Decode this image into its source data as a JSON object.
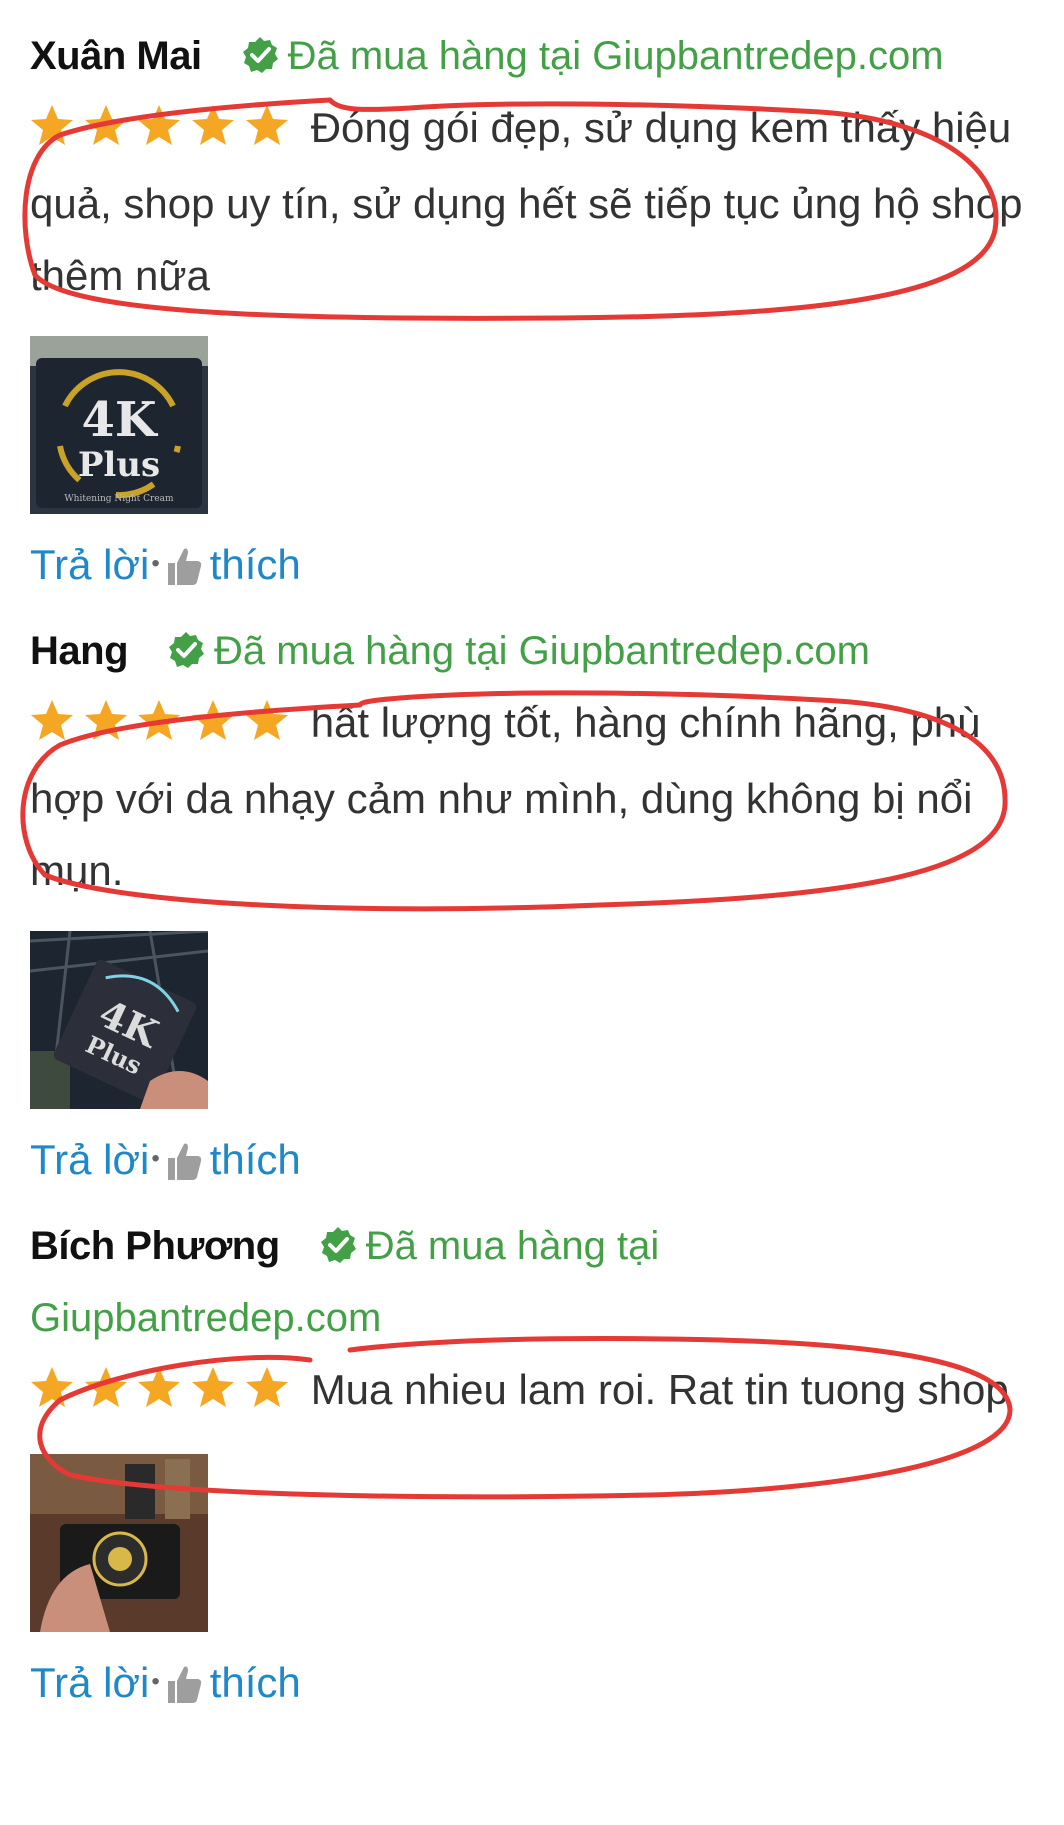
{
  "reviews": [
    {
      "author": "Xuân Mai",
      "verified_label": "Đã mua hàng tại Giupbantredep.com",
      "rating": 5,
      "text": "Đóng gói đẹp, sử dụng kem thấy hiệu quả, shop uy tín, sử dụng hết sẽ tiếp tục ủng hộ shop thêm nữa",
      "image_text": {
        "line1": "4K",
        "line2": "Plus",
        "line3": "Whitening Night Cream"
      },
      "reply_label": "Trả lời",
      "like_label": "thích"
    },
    {
      "author": "Hang",
      "verified_label": "Đã mua hàng tại Giupbantredep.com",
      "rating": 5,
      "text": "hất lượng tốt, hàng chính hãng, phù hợp với da nhạy cảm như mình, dùng không bị nổi mụn.",
      "image_text": {
        "line1": "4K",
        "line2": "Plus"
      },
      "reply_label": "Trả lời",
      "like_label": "thích"
    },
    {
      "author": "Bích Phương",
      "verified_label": "Đã mua hàng tại",
      "verified_site": "Giupbantredep.com",
      "rating": 5,
      "text": "Mua nhieu lam roi. Rat tin tuong shop",
      "reply_label": "Trả lời",
      "like_label": "thích"
    }
  ],
  "colors": {
    "verified": "#43a047",
    "action": "#1e88c8",
    "star": "#f5a623",
    "annotation": "#e53935"
  }
}
